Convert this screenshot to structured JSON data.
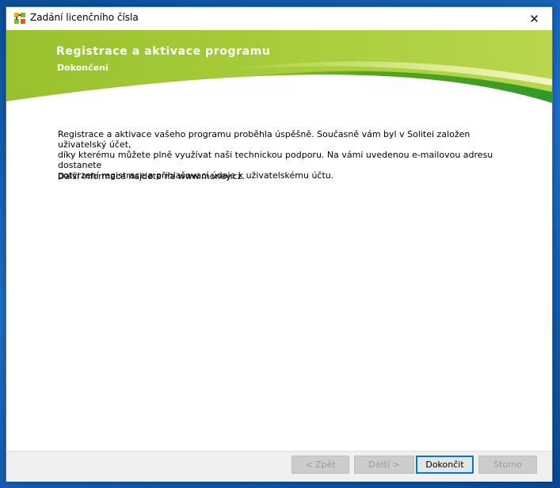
{
  "window": {
    "title": "Zadání licenčního čísla",
    "close_glyph": "✕"
  },
  "banner": {
    "title": "Registrace a aktivace programu",
    "subtitle": "Dokončení",
    "colors": {
      "green_light": "#a6c93a",
      "green_mid": "#7fb11b",
      "green_dark": "#3f9a1a"
    }
  },
  "content": {
    "paragraph1_line1": "Registrace a aktivace vašeho programu proběhla úspěšně. Současně vám byl v Solitei založen uživatelský účet,",
    "paragraph1_line2": "díky kterému můžete plně využívat naši technickou podporu. Na vámi uvedenou e-mailovou adresu dostanete",
    "paragraph1_line3": "potvrzení registrace a přihlašovací údaje k uživatelskému účtu.",
    "paragraph2": "Další informace najdete na www.money.cz."
  },
  "buttons": {
    "back": "< Zpět",
    "next": "Další >",
    "finish": "Dokončit",
    "cancel": "Storno"
  },
  "icons": {
    "app": "puzzle-app-icon",
    "close": "close-icon"
  }
}
